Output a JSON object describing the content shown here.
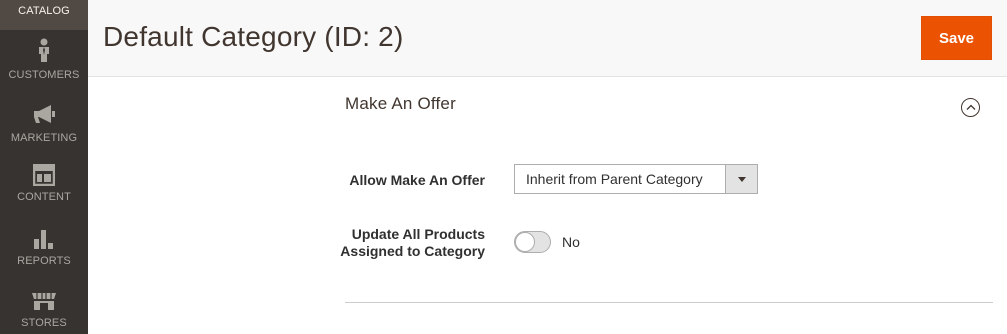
{
  "sidebar": {
    "items": [
      {
        "label": "CATALOG",
        "icon": "catalog-icon",
        "active": true
      },
      {
        "label": "CUSTOMERS",
        "icon": "customer-icon"
      },
      {
        "label": "MARKETING",
        "icon": "megaphone-icon"
      },
      {
        "label": "CONTENT",
        "icon": "layout-icon"
      },
      {
        "label": "REPORTS",
        "icon": "bar-chart-icon"
      },
      {
        "label": "STORES",
        "icon": "storefront-icon"
      }
    ]
  },
  "header": {
    "title": "Default Category (ID: 2)",
    "save_label": "Save"
  },
  "section": {
    "title": "Make An Offer",
    "collapse_icon": "chevron-up-circle-icon",
    "fields": {
      "allow": {
        "label": "Allow Make An Offer",
        "value": "Inherit from Parent Category"
      },
      "update": {
        "label": "Update All Products Assigned to Category",
        "toggle_on": false,
        "state_text": "No"
      }
    }
  },
  "colors": {
    "sidebar_bg": "#373330",
    "sidebar_active_bg": "#514943",
    "accent": "#eb5202",
    "header_bg": "#f8f8f8"
  }
}
